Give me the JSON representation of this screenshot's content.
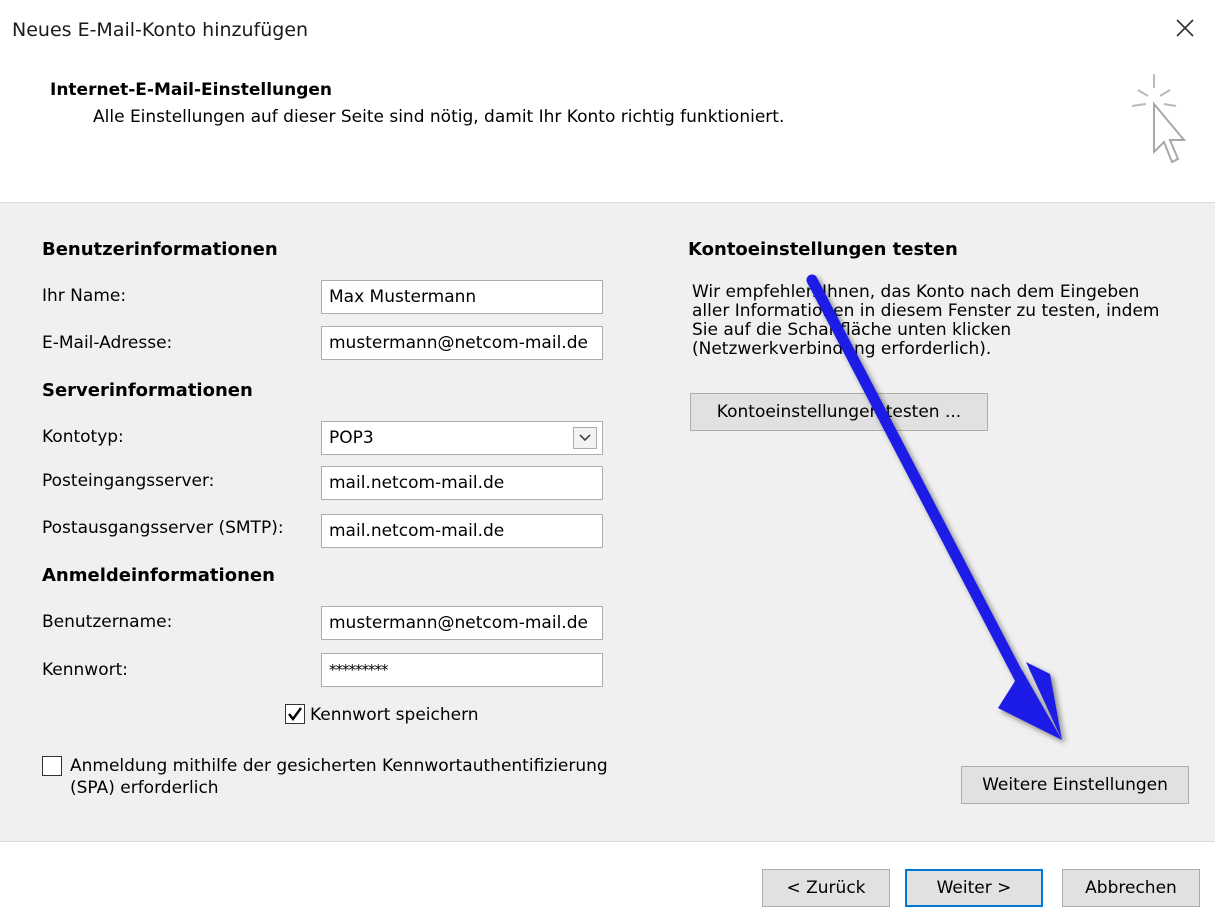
{
  "window": {
    "title": "Neues E-Mail-Konto hinzufügen"
  },
  "header": {
    "title": "Internet-E-Mail-Einstellungen",
    "subtitle": "Alle Einstellungen auf dieser Seite sind nötig, damit Ihr Konto richtig funktioniert."
  },
  "user_info": {
    "section_title": "Benutzerinformationen",
    "name_label": "Ihr Name:",
    "name_value": "Max Mustermann",
    "email_label": "E-Mail-Adresse:",
    "email_value": "mustermann@netcom-mail.de"
  },
  "server_info": {
    "section_title": "Serverinformationen",
    "account_type_label": "Kontotyp:",
    "account_type_value": "POP3",
    "incoming_label": "Posteingangsserver:",
    "incoming_value": "mail.netcom-mail.de",
    "outgoing_label": "Postausgangsserver (SMTP):",
    "outgoing_value": "mail.netcom-mail.de"
  },
  "login_info": {
    "section_title": "Anmeldeinformationen",
    "username_label": "Benutzername:",
    "username_value": "mustermann@netcom-mail.de",
    "password_label": "Kennwort:",
    "password_value": "*********",
    "save_password_label": "Kennwort speichern",
    "save_password_checked": true,
    "spa_label_line1": "Anmeldung mithilfe der gesicherten Kennwortauthentifizierung",
    "spa_label_line2": "(SPA) erforderlich",
    "spa_checked": false
  },
  "test_settings": {
    "section_title": "Kontoeinstellungen testen",
    "description_line1": "Wir empfehlen Ihnen, das Konto nach dem Eingeben",
    "description_line2": "aller Informationen in diesem Fenster zu testen, indem",
    "description_line3": "Sie auf die Schaltfläche unten klicken",
    "description_line4": "(Netzwerkverbindung erforderlich).",
    "test_button_label": "Kontoeinstellungen testen ...",
    "more_settings_label": "Weitere Einstellungen"
  },
  "footer": {
    "back_label": "< Zurück",
    "next_label": "Weiter >",
    "cancel_label": "Abbrechen"
  },
  "icons": {
    "close": "close-icon",
    "wizard": "cursor-click-icon",
    "dropdown": "chevron-down-icon",
    "checkmark": "checkmark-icon",
    "arrow": "arrow-annotation-icon"
  },
  "colors": {
    "panel_bg": "#f0f0f0",
    "button_bg": "#e1e1e1",
    "primary_border": "#0078d7",
    "arrow_blue": "#1e1ee6"
  }
}
